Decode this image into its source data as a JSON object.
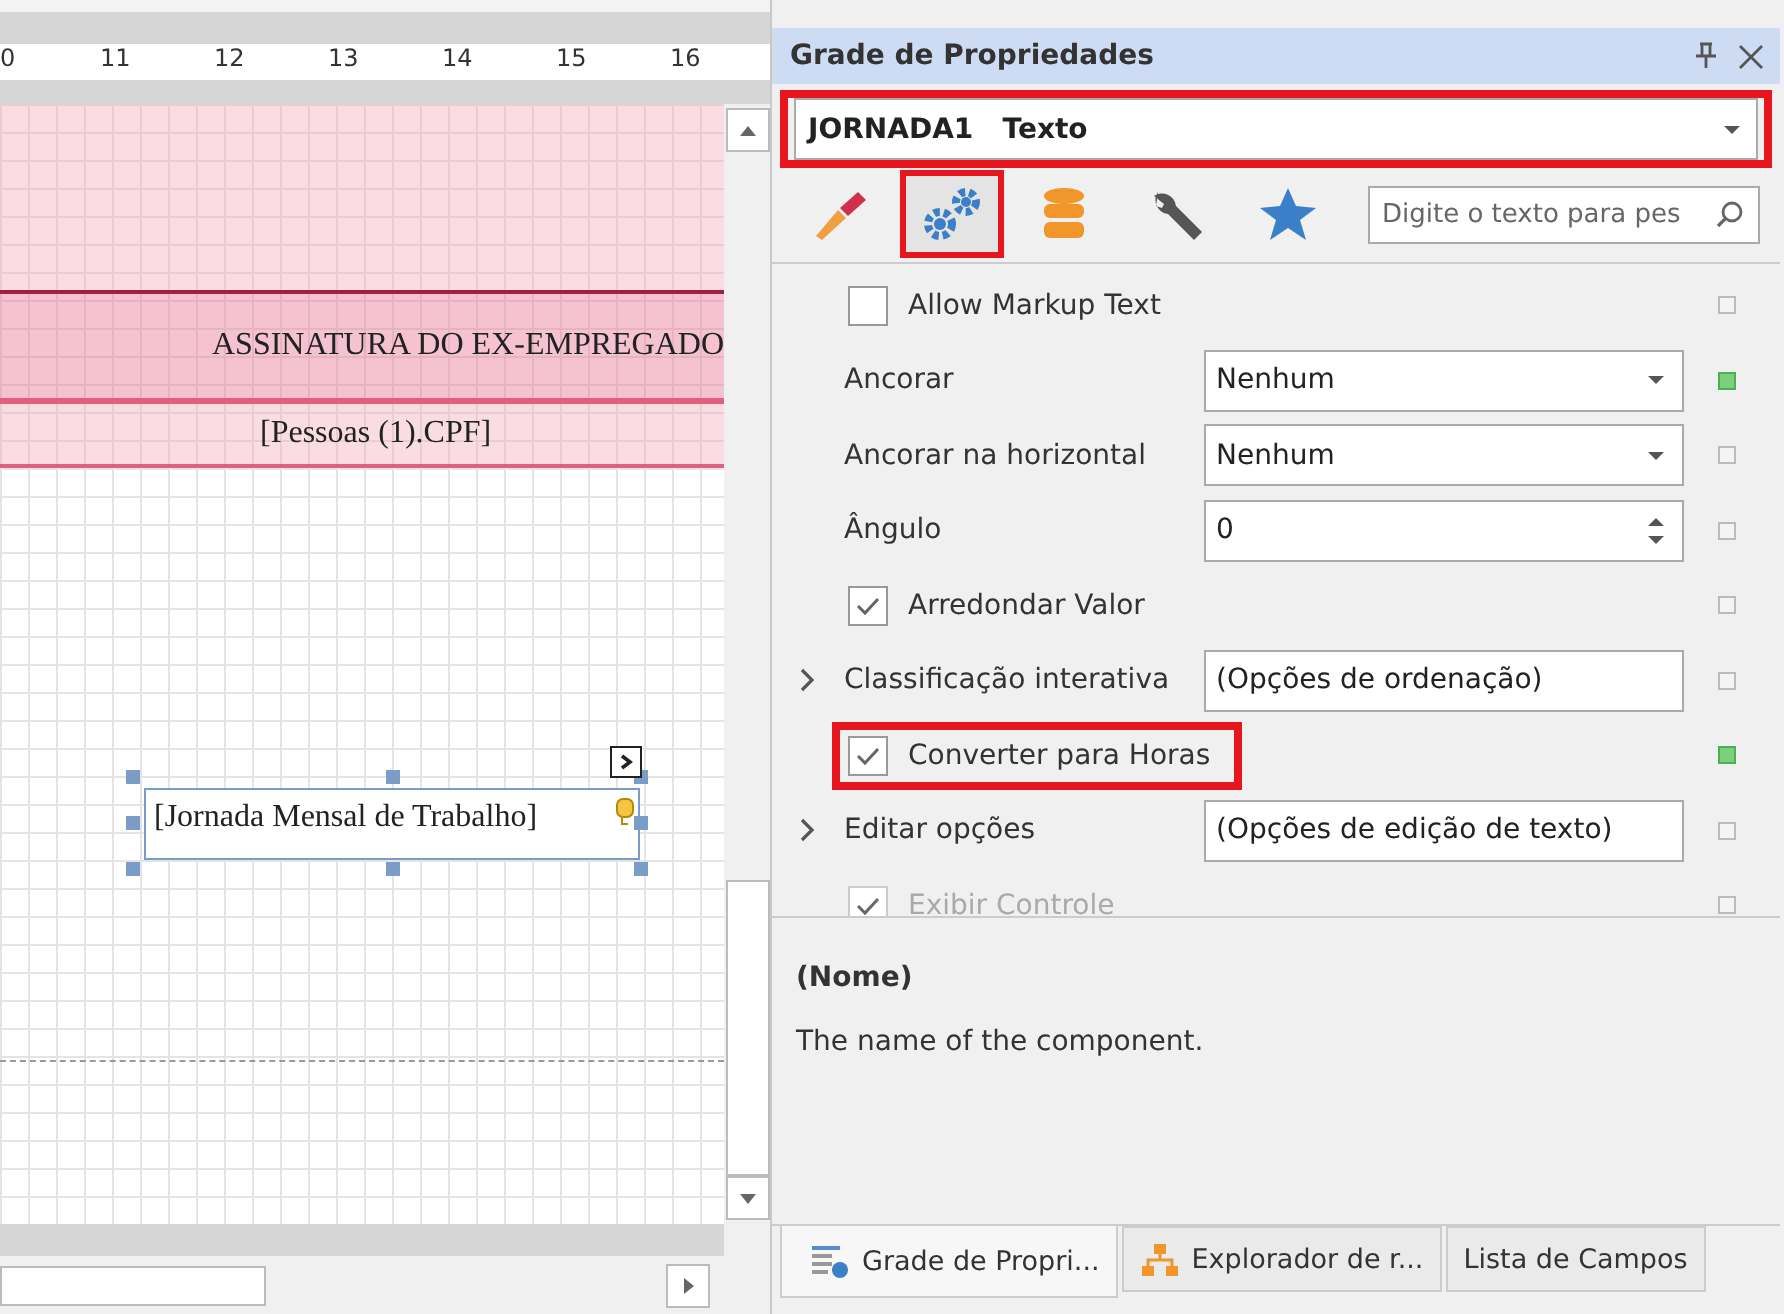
{
  "designer": {
    "ruler": [
      "0",
      "11",
      "12",
      "13",
      "14",
      "15",
      "16"
    ],
    "header_band": {
      "title": "ASSINATURA DO EX-EMPREGADO",
      "field": "[Pessoas (1).CPF]"
    },
    "selected_control": {
      "text": "[Jornada Mensal de Trabalho]",
      "selected": true
    }
  },
  "properties_panel": {
    "title": "Grade de Propriedades",
    "object_selector": {
      "value": "JORNADA1",
      "type": "Texto",
      "highlighted": true
    },
    "toolbar_tabs": [
      {
        "kind": "brush",
        "selected": false,
        "highlighted": false
      },
      {
        "kind": "gears",
        "selected": true,
        "highlighted": true
      },
      {
        "kind": "database",
        "selected": false,
        "highlighted": false
      },
      {
        "kind": "wrench",
        "selected": false,
        "highlighted": false
      },
      {
        "kind": "star",
        "selected": false,
        "highlighted": false
      }
    ],
    "search": {
      "placeholder": "Digite o texto para pes"
    },
    "properties": [
      {
        "kind": "checkbox",
        "label": "Allow Markup Text",
        "checked": false,
        "modified": false,
        "highlighted": false,
        "disabled": false
      },
      {
        "kind": "dropdown",
        "label": "Ancorar",
        "value": "Nenhum",
        "modified": true
      },
      {
        "kind": "dropdown",
        "label": "Ancorar na horizontal",
        "value": "Nenhum",
        "modified": false
      },
      {
        "kind": "spinner",
        "label": "Ângulo",
        "value": "0",
        "modified": false
      },
      {
        "kind": "checkbox",
        "label": "Arredondar Valor",
        "checked": true,
        "modified": false,
        "highlighted": false,
        "disabled": false
      },
      {
        "kind": "expandable",
        "label": "Classificação interativa",
        "value": "(Opções de ordenação)",
        "modified": false,
        "expanded": false
      },
      {
        "kind": "checkbox",
        "label": "Converter para Horas",
        "checked": true,
        "modified": true,
        "highlighted": true,
        "disabled": false
      },
      {
        "kind": "expandable",
        "label": "Editar opções",
        "value": "(Opções de edição de texto)",
        "modified": false,
        "expanded": false
      },
      {
        "kind": "checkbox",
        "label": "Exibir Controle",
        "checked": true,
        "modified": false,
        "highlighted": false,
        "disabled": true
      }
    ],
    "description": {
      "name": "(Nome)",
      "text": "The name of the component."
    },
    "bottom_tabs": [
      {
        "kind": "grid",
        "label": "Grade de Propri...",
        "selected": true
      },
      {
        "kind": "tree",
        "label": "Explorador de r...",
        "selected": false
      },
      {
        "kind": "plain",
        "label": "Lista de Campos",
        "selected": false
      }
    ]
  }
}
